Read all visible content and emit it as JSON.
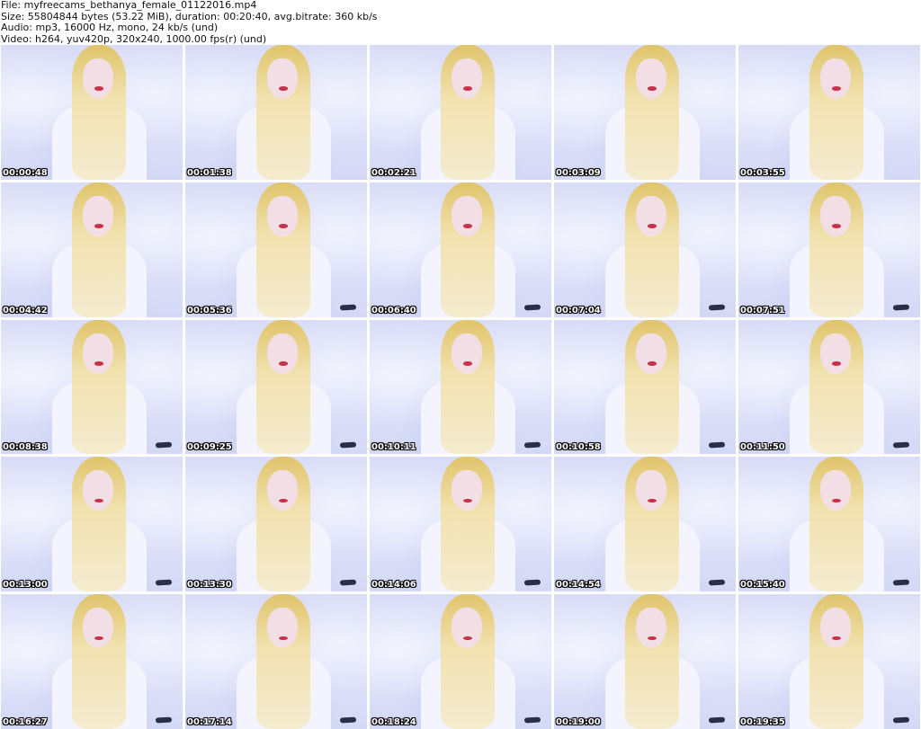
{
  "header": {
    "file": "File: myfreecams_bethanya_female_01122016.mp4",
    "size": "Size: 55804844 bytes (53.22 MiB), duration: 00:20:40, avg.bitrate: 360 kb/s",
    "audio": "Audio: mp3, 16000 Hz, mono, 24 kb/s (und)",
    "video": "Video: h264, yuv420p, 320x240, 1000.00 fps(r) (und)"
  },
  "thumbnails": [
    {
      "time": "00:00:48"
    },
    {
      "time": "00:01:38"
    },
    {
      "time": "00:02:21"
    },
    {
      "time": "00:03:09"
    },
    {
      "time": "00:03:55"
    },
    {
      "time": "00:04:42"
    },
    {
      "time": "00:05:36"
    },
    {
      "time": "00:06:40"
    },
    {
      "time": "00:07:04"
    },
    {
      "time": "00:07:51"
    },
    {
      "time": "00:08:38"
    },
    {
      "time": "00:09:25"
    },
    {
      "time": "00:10:11"
    },
    {
      "time": "00:10:58"
    },
    {
      "time": "00:11:50"
    },
    {
      "time": "00:13:00"
    },
    {
      "time": "00:13:30"
    },
    {
      "time": "00:14:06"
    },
    {
      "time": "00:14:54"
    },
    {
      "time": "00:15:40"
    },
    {
      "time": "00:16:27"
    },
    {
      "time": "00:17:14"
    },
    {
      "time": "00:18:24"
    },
    {
      "time": "00:19:00"
    },
    {
      "time": "00:19:35"
    }
  ]
}
